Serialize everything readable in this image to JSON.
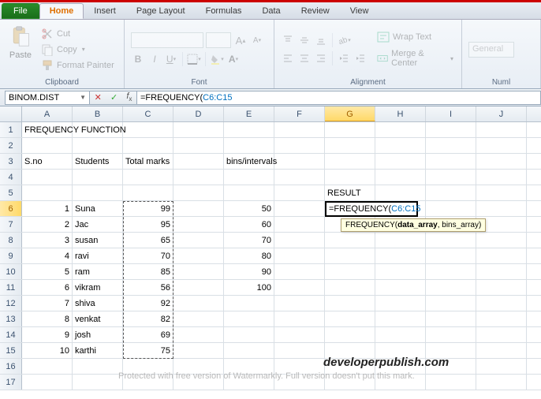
{
  "tabs": {
    "file": "File",
    "home": "Home",
    "insert": "Insert",
    "pageLayout": "Page Layout",
    "formulas": "Formulas",
    "data": "Data",
    "review": "Review",
    "view": "View"
  },
  "ribbon": {
    "clipboard": {
      "label": "Clipboard",
      "paste": "Paste",
      "cut": "Cut",
      "copy": "Copy",
      "formatPainter": "Format Painter"
    },
    "font": {
      "label": "Font",
      "name": "",
      "size": "",
      "grow": "A",
      "shrink": "A"
    },
    "alignment": {
      "label": "Alignment",
      "wrap": "Wrap Text",
      "merge": "Merge & Center"
    },
    "number": {
      "label": "Numl",
      "general": "General"
    }
  },
  "fx": {
    "nameBox": "BINOM.DIST",
    "formula_pre": "=FREQUENCY(",
    "formula_ref": "C6:C15",
    "formula_post": ""
  },
  "cols": [
    "A",
    "B",
    "C",
    "D",
    "E",
    "F",
    "G",
    "H",
    "I",
    "J"
  ],
  "sheet": {
    "a1": "FREQUENCY FUNCTION",
    "a3": "S.no",
    "b3": "Students",
    "c3": "Total marks",
    "e3": "bins/intervals",
    "g5": "RESULT",
    "rows": [
      {
        "n": "1",
        "stu": "Suna",
        "m": "99",
        "bin": "50"
      },
      {
        "n": "2",
        "stu": "Jac",
        "m": "95",
        "bin": "60"
      },
      {
        "n": "3",
        "stu": "susan",
        "m": "65",
        "bin": "70"
      },
      {
        "n": "4",
        "stu": "ravi",
        "m": "70",
        "bin": "80"
      },
      {
        "n": "5",
        "stu": "ram",
        "m": "85",
        "bin": "90"
      },
      {
        "n": "6",
        "stu": "vikram",
        "m": "56",
        "bin": "100"
      },
      {
        "n": "7",
        "stu": "shiva",
        "m": "92",
        "bin": ""
      },
      {
        "n": "8",
        "stu": "venkat",
        "m": "82",
        "bin": ""
      },
      {
        "n": "9",
        "stu": "josh",
        "m": "69",
        "bin": ""
      },
      {
        "n": "10",
        "stu": "karthi",
        "m": "75",
        "bin": ""
      }
    ],
    "g6": {
      "pre": "=FREQUENCY(",
      "ref": "C6:C15",
      "post": ""
    }
  },
  "tooltip": {
    "fn": "FREQUENCY(",
    "b": "data_array",
    "rest": ", bins_array)"
  },
  "watermark": {
    "brand": "developerpublish.com",
    "note": "Protected with free version of Watermarkly. Full version doesn't put this mark."
  }
}
